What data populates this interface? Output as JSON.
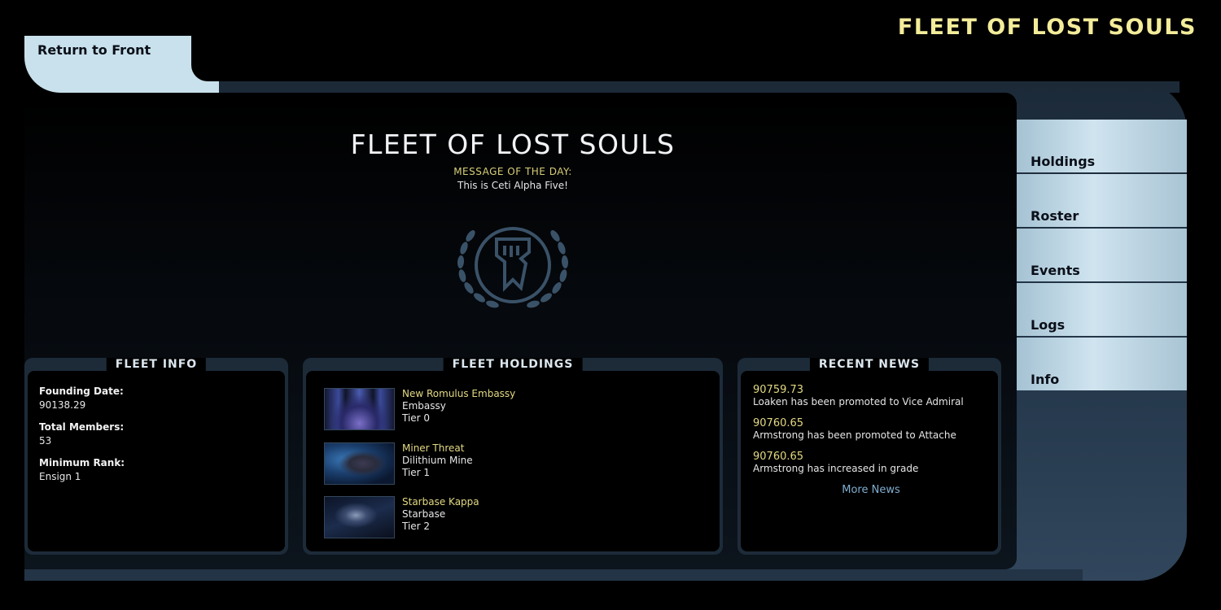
{
  "site_title": "FLEET OF LOST SOULS",
  "return_label": "Return to Front",
  "nav": [
    {
      "label": "Holdings"
    },
    {
      "label": "Roster"
    },
    {
      "label": "Events"
    },
    {
      "label": "Logs"
    },
    {
      "label": "Info"
    }
  ],
  "hero": {
    "title": "FLEET OF LOST SOULS",
    "motd_label": "MESSAGE OF THE DAY:",
    "motd_text": "This is Ceti Alpha Five!"
  },
  "fleet_info": {
    "title": "FLEET INFO",
    "items": [
      {
        "label": "Founding Date:",
        "value": "90138.29"
      },
      {
        "label": "Total Members:",
        "value": "53"
      },
      {
        "label": "Minimum Rank:",
        "value": "Ensign 1"
      }
    ]
  },
  "holdings": {
    "title": "FLEET HOLDINGS",
    "items": [
      {
        "name": "New Romulus Embassy",
        "type": "Embassy",
        "tier": "Tier 0"
      },
      {
        "name": "Miner Threat",
        "type": "Dilithium Mine",
        "tier": "Tier 1"
      },
      {
        "name": "Starbase Kappa",
        "type": "Starbase",
        "tier": "Tier 2"
      }
    ]
  },
  "news": {
    "title": "RECENT NEWS",
    "items": [
      {
        "stamp": "90759.73",
        "text": "Loaken has been promoted to Vice Admiral"
      },
      {
        "stamp": "90760.65",
        "text": "Armstrong has been promoted to Attache"
      },
      {
        "stamp": "90760.65",
        "text": "Armstrong has increased in grade"
      }
    ],
    "more_label": "More News"
  },
  "colors": {
    "accent_gold": "#f3ec9a",
    "nav_blue": "#c9e1ec",
    "frame": "#1c2a38",
    "link_blue": "#7faed0"
  }
}
